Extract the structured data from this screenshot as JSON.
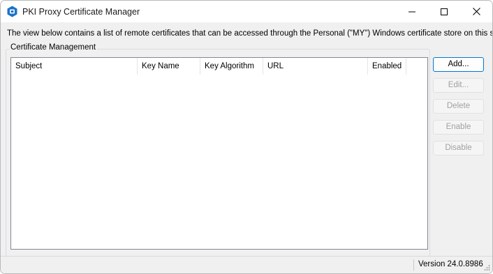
{
  "window": {
    "title": "PKI Proxy Certificate Manager",
    "icon": "pki-shield-icon",
    "accent": "#0078d4"
  },
  "description": "The view below contains a list of remote certificates that can be accessed through the Personal (\"MY\") Windows certificate store on this system.",
  "group": {
    "label": "Certificate Management"
  },
  "table": {
    "columns": [
      "Subject",
      "Key Name",
      "Key Algorithm",
      "URL",
      "Enabled"
    ],
    "rows": []
  },
  "buttons": {
    "add": "Add...",
    "edit": "Edit...",
    "delete": "Delete",
    "enable": "Enable",
    "disable": "Disable"
  },
  "status": {
    "version": "Version 24.0.8986"
  }
}
